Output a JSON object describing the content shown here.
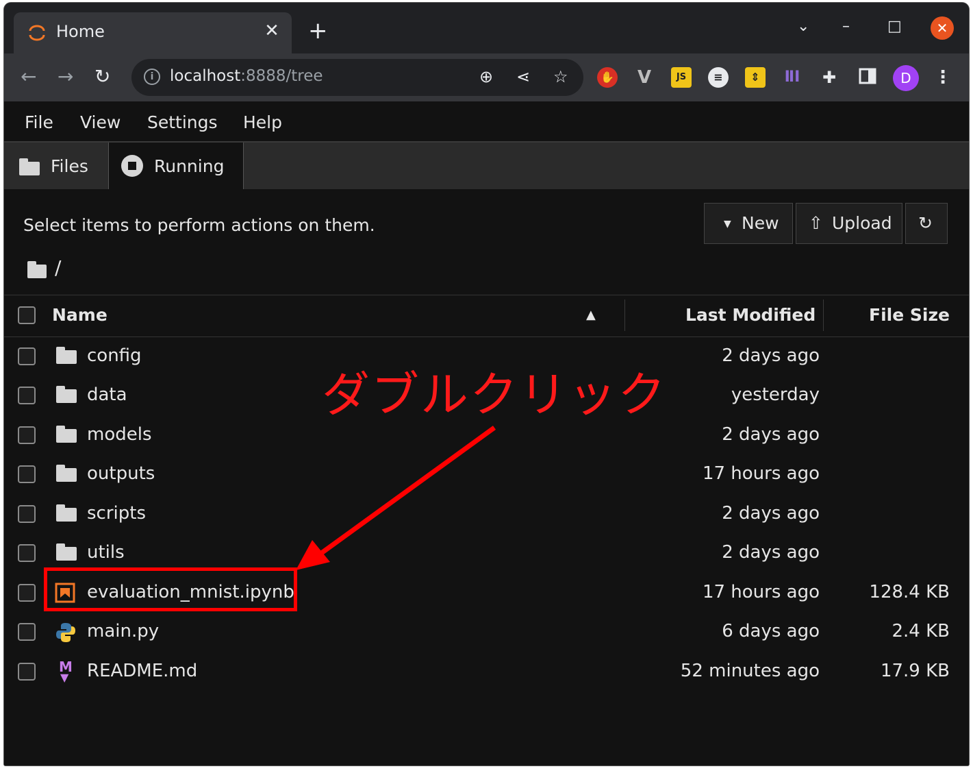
{
  "browser": {
    "tab_title": "Home",
    "tab_close": "✕",
    "new_tab": "+",
    "url_host": "localhost",
    "url_rest": ":8888/tree",
    "profile_initial": "D",
    "ext_js_label": "JS"
  },
  "menu": {
    "file": "File",
    "view": "View",
    "settings": "Settings",
    "help": "Help"
  },
  "tabs": {
    "files": "Files",
    "running": "Running"
  },
  "toolbar": {
    "hint": "Select items to perform actions on them.",
    "new_label": "New",
    "upload_label": "Upload"
  },
  "breadcrumb": {
    "path": "/"
  },
  "table": {
    "headers": {
      "name": "Name",
      "modified": "Last Modified",
      "size": "File Size"
    },
    "rows": [
      {
        "name": "config",
        "modified": "2 days ago",
        "size": "",
        "type": "folder"
      },
      {
        "name": "data",
        "modified": "yesterday",
        "size": "",
        "type": "folder"
      },
      {
        "name": "models",
        "modified": "2 days ago",
        "size": "",
        "type": "folder"
      },
      {
        "name": "outputs",
        "modified": "17 hours ago",
        "size": "",
        "type": "folder"
      },
      {
        "name": "scripts",
        "modified": "2 days ago",
        "size": "",
        "type": "folder"
      },
      {
        "name": "utils",
        "modified": "2 days ago",
        "size": "",
        "type": "folder"
      },
      {
        "name": "evaluation_mnist.ipynb",
        "modified": "17 hours ago",
        "size": "128.4 KB",
        "type": "notebook"
      },
      {
        "name": "main.py",
        "modified": "6 days ago",
        "size": "2.4 KB",
        "type": "python"
      },
      {
        "name": "README.md",
        "modified": "52 minutes ago",
        "size": "17.9 KB",
        "type": "markdown"
      }
    ]
  },
  "annotation": {
    "text": "ダブルクリック",
    "color": "#ff0000"
  },
  "colors": {
    "accent": "#e95420",
    "background": "#121212"
  }
}
